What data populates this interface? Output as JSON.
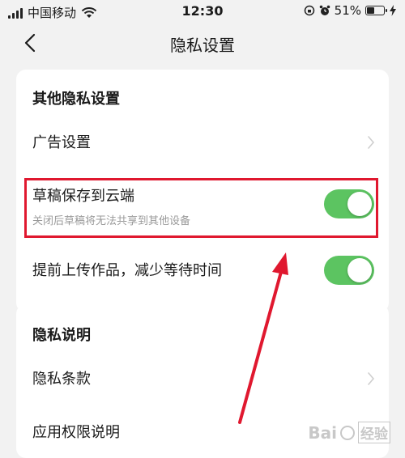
{
  "status_bar": {
    "carrier": "中国移动",
    "time": "12:30",
    "battery_percent": "51%",
    "battery_level": 0.51,
    "icons": [
      "signal-icon",
      "wifi-icon",
      "lock-rotation-icon",
      "alarm-icon",
      "battery-icon",
      "charging-icon"
    ]
  },
  "nav": {
    "title": "隐私设置",
    "back_icon": "chevron-left-icon"
  },
  "section1": {
    "title": "其他隐私设置",
    "items": [
      {
        "label": "广告设置",
        "type": "chevron"
      },
      {
        "label": "草稿保存到云端",
        "subtitle": "关闭后草稿将无法共享到其他设备",
        "type": "toggle",
        "on": true
      },
      {
        "label": "提前上传作品，减少等待时间",
        "type": "toggle",
        "on": true
      }
    ]
  },
  "section2": {
    "title": "隐私说明",
    "items": [
      {
        "label": "隐私条款",
        "type": "chevron"
      },
      {
        "label": "应用权限说明",
        "type": "chevron"
      }
    ]
  },
  "annotation": {
    "highlight_color": "#e0182f",
    "toggle_color": "#5cc461"
  },
  "watermark": {
    "brand": "Bai",
    "suffix": "经验"
  }
}
